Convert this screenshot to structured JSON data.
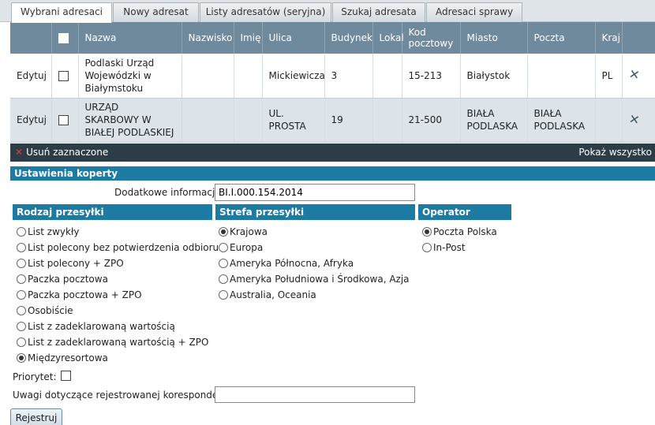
{
  "tabs": [
    {
      "label": "Wybrani adresaci",
      "active": true
    },
    {
      "label": "Nowy adresat",
      "active": false
    },
    {
      "label": "Listy adresatów (seryjna)",
      "active": false
    },
    {
      "label": "Szukaj adresata",
      "active": false
    },
    {
      "label": "Adresaci sprawy",
      "active": false
    }
  ],
  "table": {
    "headers": [
      "Nazwa",
      "Nazwisko",
      "Imię",
      "Ulica",
      "Budynek",
      "Lokal",
      "Kod pocztowy",
      "Miasto",
      "Poczta",
      "Kraj"
    ],
    "rows": [
      {
        "edit": "Edytuj",
        "nazwa": "Podlaski Urząd Wojewódzki w Białymstoku",
        "nazwisko": "",
        "imie": "",
        "ulica": "Mickiewicza",
        "budynek": "3",
        "lokal": "",
        "kod": "15-213",
        "miasto": "Białystok",
        "poczta": "",
        "kraj": "PL"
      },
      {
        "edit": "Edytuj",
        "nazwa": "URZĄD SKARBOWY W BIAŁEJ PODLASKIEJ",
        "nazwisko": "",
        "imie": "",
        "ulica": "UL. PROSTA",
        "budynek": "19",
        "lokal": "",
        "kod": "21-500",
        "miasto": "BIAŁA PODLASKA",
        "poczta": "BIAŁA PODLASKA",
        "kraj": ""
      }
    ],
    "delete_selected": "Usuń zaznaczone",
    "show_all": "Pokaż wszystko"
  },
  "envelope": {
    "title": "Ustawienia koperty",
    "additional_info_label": "Dodatkowe informacje:",
    "additional_info_value": "BI.I.000.154.2014"
  },
  "shipment_type": {
    "title": "Rodzaj przesyłki",
    "options": [
      {
        "label": "List zwykły",
        "selected": false
      },
      {
        "label": "List polecony bez potwierdzenia odbioru",
        "selected": false
      },
      {
        "label": "List polecony + ZPO",
        "selected": false
      },
      {
        "label": "Paczka pocztowa",
        "selected": false
      },
      {
        "label": "Paczka pocztowa + ZPO",
        "selected": false
      },
      {
        "label": "Osobiście",
        "selected": false
      },
      {
        "label": "List z zadeklarowaną wartością",
        "selected": false
      },
      {
        "label": "List z zadeklarowaną wartością + ZPO",
        "selected": false
      },
      {
        "label": "Międzyresortowa",
        "selected": true
      }
    ]
  },
  "shipment_zone": {
    "title": "Strefa przesyłki",
    "options": [
      {
        "label": "Krajowa",
        "selected": true
      },
      {
        "label": "Europa",
        "selected": false
      },
      {
        "label": "Ameryka Północna, Afryka",
        "selected": false
      },
      {
        "label": "Ameryka Południowa i Środkowa, Azja",
        "selected": false
      },
      {
        "label": "Australia, Oceania",
        "selected": false
      }
    ]
  },
  "postal_operator": {
    "title": "Operator pocztowy",
    "options": [
      {
        "label": "Poczta Polska",
        "selected": true
      },
      {
        "label": "In-Post",
        "selected": false
      }
    ]
  },
  "priority_label": "Priorytet:",
  "priority_checked": false,
  "notes_label": "Uwagi dotyczące rejestrowanej korespondencji:",
  "notes_value": "",
  "register_button": "Rejestruj"
}
